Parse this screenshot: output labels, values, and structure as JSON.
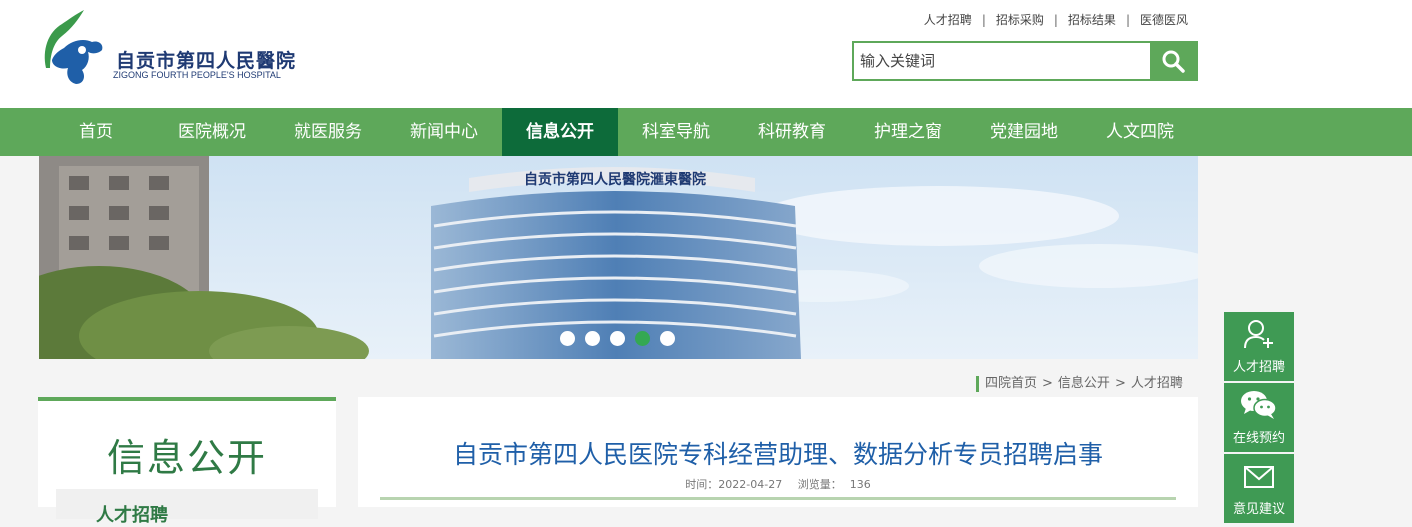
{
  "header": {
    "logo_cn": "自贡市第四人民醫院",
    "logo_en": "ZIGONG FOURTH PEOPLE'S HOSPITAL",
    "top_links": [
      "人才招聘",
      "招标采购",
      "招标结果",
      "医德医风"
    ],
    "top_link_separator": "|",
    "search_placeholder": "输入关键词"
  },
  "nav": {
    "items": [
      "首页",
      "医院概况",
      "就医服务",
      "新闻中心",
      "信息公开",
      "科室导航",
      "科研教育",
      "护理之窗",
      "党建园地",
      "人文四院"
    ],
    "active_index": 4
  },
  "banner": {
    "building_sign": "自贡市第四人民醫院滙東醫院",
    "slide_count": 5,
    "active_slide": 4
  },
  "breadcrumb": {
    "items": [
      "四院首页",
      "信息公开",
      "人才招聘"
    ],
    "separator": ">"
  },
  "sidebar": {
    "title": "信息公开",
    "current_item": "人才招聘"
  },
  "article": {
    "title": "自贡市第四人民医院专科经营助理、数据分析专员招聘启事",
    "time_label": "时间：",
    "time_value": "2022-04-27",
    "views_label": "浏览量：",
    "views_value": "136"
  },
  "float_bar": {
    "items": [
      {
        "label": "人才招聘",
        "icon": "user-add-icon"
      },
      {
        "label": "在线预约",
        "icon": "wechat-icon"
      },
      {
        "label": "意见建议",
        "icon": "envelope-icon"
      }
    ]
  },
  "colors": {
    "brand_green": "#5ea85a",
    "nav_active": "#0d6b3a",
    "title_blue": "#1f5fa8",
    "float_green": "#3f9a54"
  }
}
